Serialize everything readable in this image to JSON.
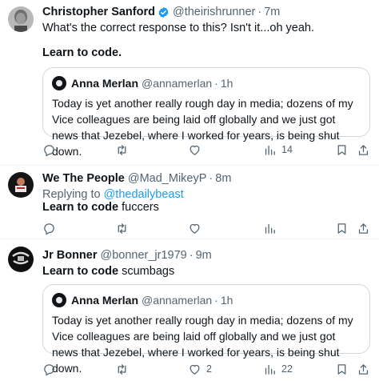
{
  "tweets": [
    {
      "name": "Christopher Sanford",
      "verified": true,
      "handle": "@theirishrunner",
      "sep": "·",
      "time": "7m",
      "line1": "What's the correct response to this? Isn't it...oh yeah.",
      "line2": "Learn to code.",
      "quote": {
        "name": "Anna Merlan",
        "handle": "@annamerlan",
        "sep": "·",
        "time": "1h",
        "text": "Today is yet another really rough day in media; dozens of my Vice colleagues are being laid off globally and we just got news that Jezebel, where I worked for years, is being shut down."
      },
      "actions": {
        "reply": "",
        "retweet": "",
        "like": "",
        "views": "14"
      },
      "avatar_color": "#8a8a8a"
    },
    {
      "name": "We The People",
      "handle": "@Mad_MikeyP",
      "sep": "·",
      "time": "8m",
      "reply_prefix": "Replying to",
      "reply_target": "@thedailybeast",
      "text_bold": "Learn to code",
      "text_rest": " fuccers",
      "actions": {
        "reply": "",
        "retweet": "",
        "like": "",
        "views": ""
      },
      "avatar_color": "#1a1a1a"
    },
    {
      "name": "Jr Bonner",
      "handle": "@bonner_jr1979",
      "sep": "·",
      "time": "9m",
      "text_bold": "Learn to code",
      "text_rest": " scumbags",
      "quote": {
        "name": "Anna Merlan",
        "handle": "@annamerlan",
        "sep": "·",
        "time": "1h",
        "text": "Today is yet another really rough day in media; dozens of my Vice colleagues are being laid off globally and we just got news that Jezebel, where I worked for years, is being shut down."
      },
      "actions": {
        "reply": "",
        "retweet": "",
        "like": "2",
        "views": "22"
      },
      "avatar_color": "#111111"
    }
  ],
  "colors": {
    "text": "#0f1419",
    "secondary": "#536471",
    "link": "#1d9bf0",
    "verified": "#1d9bf0",
    "border": "#cfd9de"
  }
}
